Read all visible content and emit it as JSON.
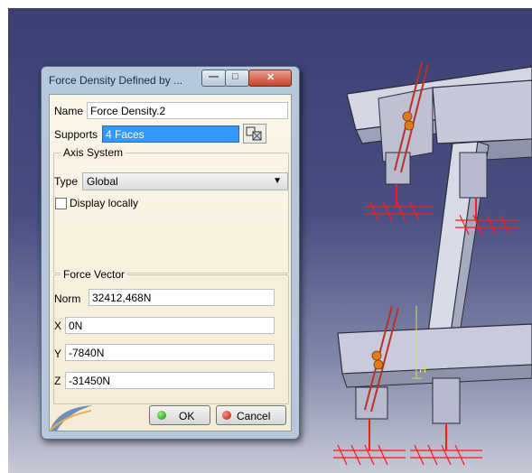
{
  "dialog": {
    "title": "Force Density Defined by ...",
    "name_label": "Name",
    "name_value": "Force Density.2",
    "supports_label": "Supports",
    "supports_value": "4 Faces",
    "axis_system": {
      "legend": "Axis System",
      "type_label": "Type",
      "type_value": "Global",
      "display_locally_label": "Display locally",
      "display_locally_checked": false
    },
    "force_vector": {
      "legend": "Force Vector",
      "norm_label": "Norm",
      "norm_value": "32412,468N",
      "x_label": "X",
      "x_value": "0N",
      "y_label": "Y",
      "y_value": "-7840N",
      "z_label": "Z",
      "z_value": "-31450N"
    },
    "ok_label": "OK",
    "cancel_label": "Cancel"
  },
  "viewport": {
    "axis_label": "H",
    "colors": {
      "background_top": "#3b3f74",
      "background_bottom": "#c8cad6",
      "structure": "#c9cbdc",
      "force_arrows": "#b8322a",
      "restraints": "#ff1a1a",
      "symbol": "#e07a1a"
    }
  }
}
